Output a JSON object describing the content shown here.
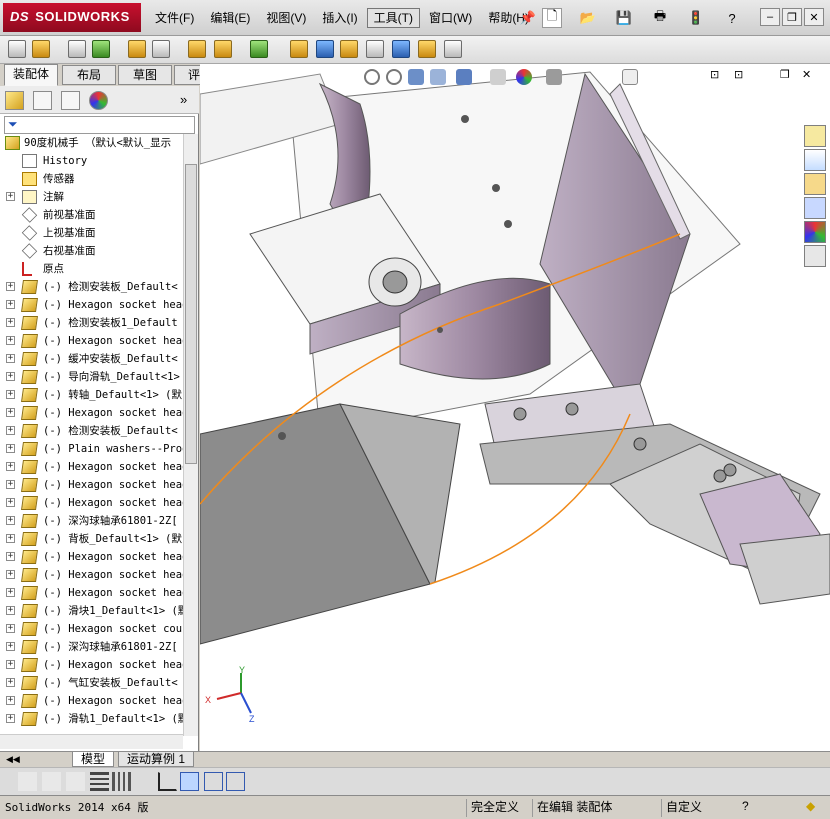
{
  "app": {
    "brand": "SOLIDWORKS",
    "brand_prefix": "DS"
  },
  "menu": [
    "文件(F)",
    "编辑(E)",
    "视图(V)",
    "插入(I)",
    "工具(T)",
    "窗口(W)",
    "帮助(H)"
  ],
  "active_menu": "工具(T)",
  "tabs": [
    "装配体",
    "布局",
    "草图",
    "评估"
  ],
  "active_tab": "装配体",
  "tree": {
    "root": "90度机械手 （默认<默认_显示",
    "items": [
      {
        "label": "History",
        "icon": "history-icon",
        "exp": false
      },
      {
        "label": "传感器",
        "icon": "sensor-icon",
        "exp": false
      },
      {
        "label": "注解",
        "icon": "annotation-icon",
        "exp": true
      },
      {
        "label": "前视基准面",
        "icon": "plane-icon",
        "exp": false
      },
      {
        "label": "上视基准面",
        "icon": "plane-icon",
        "exp": false
      },
      {
        "label": "右视基准面",
        "icon": "plane-icon",
        "exp": false
      },
      {
        "label": "原点",
        "icon": "origin-icon",
        "exp": false
      },
      {
        "label": "(-) 检测安装板_Default<",
        "icon": "part-icon",
        "exp": true
      },
      {
        "label": "(-) Hexagon socket head",
        "icon": "part-icon",
        "exp": true
      },
      {
        "label": "(-) 检测安装板1_Default",
        "icon": "part-icon",
        "exp": true
      },
      {
        "label": "(-) Hexagon socket head",
        "icon": "part-icon",
        "exp": true
      },
      {
        "label": "(-) 缓冲安装板_Default<",
        "icon": "part-icon",
        "exp": true
      },
      {
        "label": "(-) 导向滑轨_Default<1>",
        "icon": "part-icon",
        "exp": true
      },
      {
        "label": "(-) 转轴_Default<1> (默",
        "icon": "part-icon",
        "exp": true
      },
      {
        "label": "(-) Hexagon socket head",
        "icon": "part-icon",
        "exp": true
      },
      {
        "label": "(-) 检测安装板_Default<",
        "icon": "part-icon",
        "exp": true
      },
      {
        "label": "(-) Plain washers--Prod",
        "icon": "part-icon",
        "exp": true
      },
      {
        "label": "(-) Hexagon socket head",
        "icon": "part-icon",
        "exp": true
      },
      {
        "label": "(-) Hexagon socket head",
        "icon": "part-icon",
        "exp": true
      },
      {
        "label": "(-) Hexagon socket head",
        "icon": "part-icon",
        "exp": true
      },
      {
        "label": "(-) 深沟球轴承61801-2Z[",
        "icon": "part-icon",
        "exp": true
      },
      {
        "label": "(-) 背板_Default<1> (默",
        "icon": "part-icon",
        "exp": true
      },
      {
        "label": "(-) Hexagon socket head",
        "icon": "part-icon",
        "exp": true
      },
      {
        "label": "(-) Hexagon socket head",
        "icon": "part-icon",
        "exp": true
      },
      {
        "label": "(-) Hexagon socket head",
        "icon": "part-icon",
        "exp": true
      },
      {
        "label": "(-) 滑块1_Default<1> (默",
        "icon": "part-icon",
        "exp": true
      },
      {
        "label": "(-) Hexagon socket coun",
        "icon": "part-icon",
        "exp": true
      },
      {
        "label": "(-) 深沟球轴承61801-2Z[",
        "icon": "part-icon",
        "exp": true
      },
      {
        "label": "(-) Hexagon socket head",
        "icon": "part-icon",
        "exp": true
      },
      {
        "label": "(-) 气缸安装板_Default<",
        "icon": "part-icon",
        "exp": true
      },
      {
        "label": "(-) Hexagon socket head",
        "icon": "part-icon",
        "exp": true
      },
      {
        "label": "(-) 滑轨1_Default<1> (默",
        "icon": "part-icon",
        "exp": true
      }
    ]
  },
  "bottom_tabs": [
    "模型",
    "运动算例 1"
  ],
  "active_bottom_tab": "模型",
  "triad": {
    "x": "X",
    "y": "Y",
    "z": "Z"
  },
  "status": {
    "app": "SolidWorks 2014 x64 版",
    "state": "完全定义",
    "mode": "在编辑 装配体",
    "custom": "自定义"
  }
}
